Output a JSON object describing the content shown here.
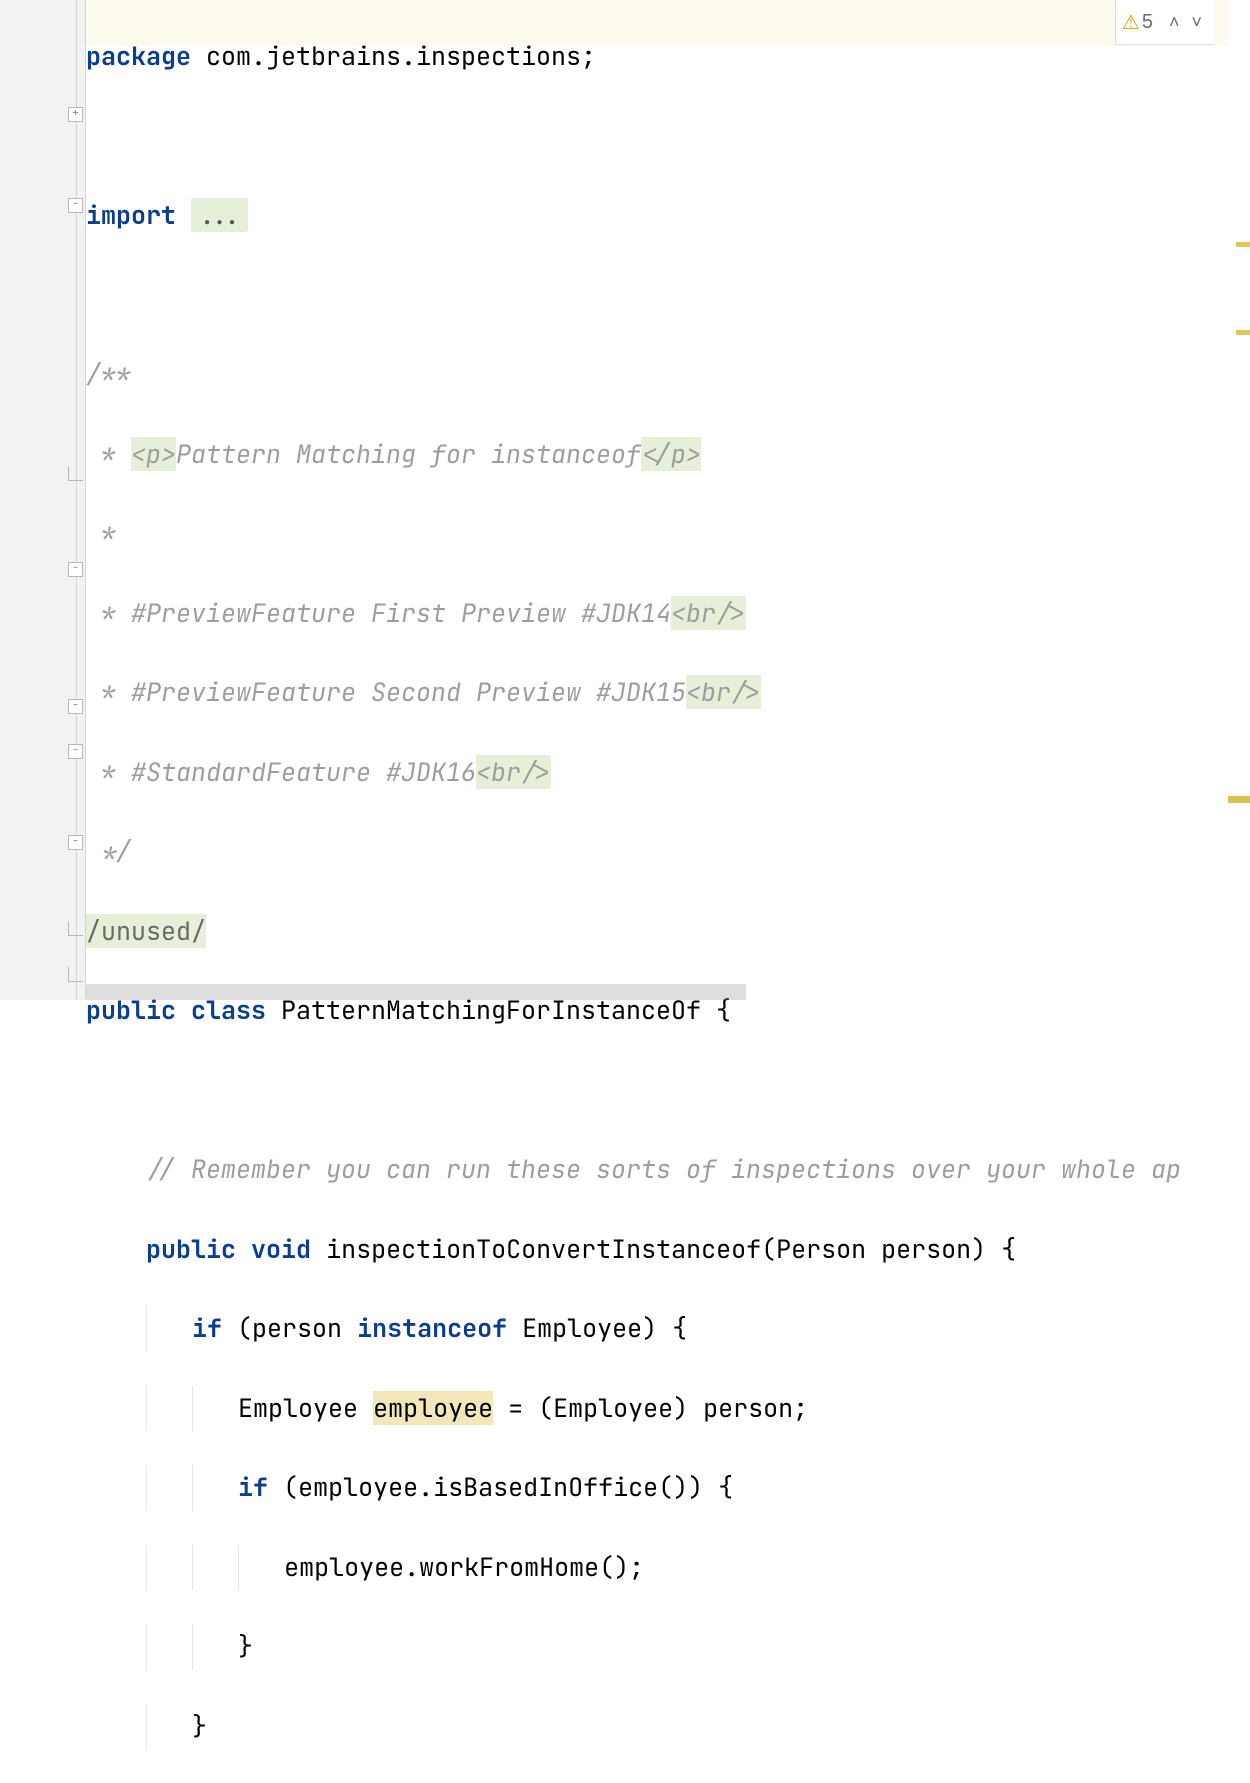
{
  "inspections": {
    "warning_count": "5"
  },
  "code": {
    "kw_package": "package",
    "package_name": " com.jetbrains.inspections;",
    "kw_import": "import",
    "import_fold": "...",
    "doc_open": "/**",
    "doc_l2a": " * ",
    "doc_tag_p_open": "<p>",
    "doc_l2b": "Pattern Matching for instanceof",
    "doc_tag_p_close": "</p>",
    "doc_l3": " *",
    "doc_l4a": " * #PreviewFeature First Preview #JDK14",
    "doc_tag_br": "<br/>",
    "doc_l5a": " * #PreviewFeature Second Preview #JDK15",
    "doc_l6a": " * #StandardFeature #JDK16",
    "doc_close": " */",
    "unused": "/unused/",
    "kw_public": "public",
    "kw_class": "class",
    "class_decl": " PatternMatchingForInstanceOf {",
    "comment_remember": "// Remember you can run these sorts of inspections over your whole ap",
    "kw_void": "void",
    "method_sig": " inspectionToConvertInstanceof(Person person) {",
    "kw_if": "if",
    "if1_a": " (person ",
    "kw_instanceof": "instanceof",
    "if1_b": " Employee) {",
    "decl_a": "Employee ",
    "decl_var": "employee",
    "decl_b": " = (Employee) person;",
    "if2": " (employee.isBasedInOffice()) {",
    "call": "employee.workFromHome();",
    "brace": "}"
  }
}
